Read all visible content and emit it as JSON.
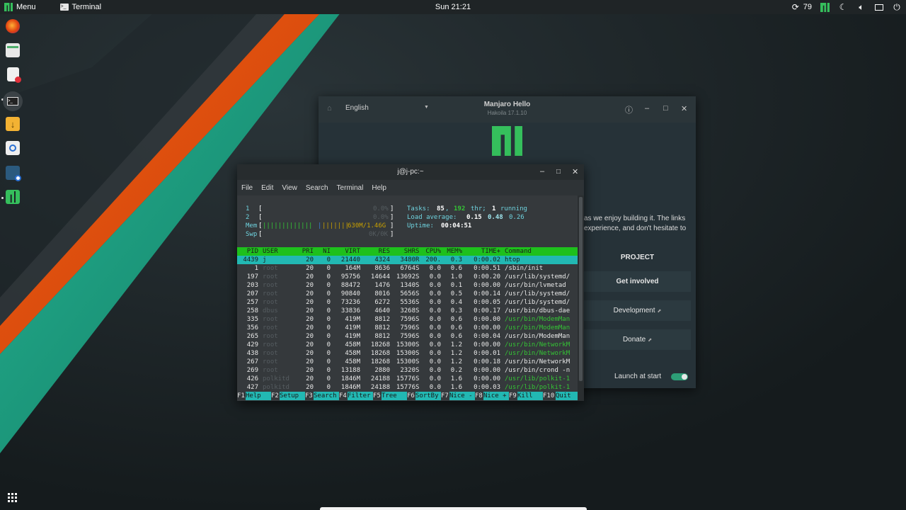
{
  "panel": {
    "menu_label": "Menu",
    "task_label": "Terminal",
    "clock": "Sun 21:21",
    "updates_count": "79"
  },
  "colors": {
    "accent": "#35bf5c",
    "orange_stripe": "#e4510e",
    "teal_stripe": "#1ea285",
    "htop_header": "#1ec01c",
    "htop_selected": "#22b8b3"
  },
  "dock": {
    "icons": [
      "firefox-icon",
      "file-manager-icon",
      "document-viewer-icon",
      "terminal-icon",
      "downloader-icon",
      "screenshot-icon",
      "settings-icon",
      "manjaro-hello-icon"
    ]
  },
  "hello": {
    "language": "English",
    "title": "Manjaro Hello",
    "subtitle": "Hakoila 17.1.10",
    "intro_line1": "as we enjoy building it. The links",
    "intro_line2": "experience, and don't hesitate to",
    "section_project": "PROJECT",
    "get_involved": "Get involved",
    "development": "Development",
    "donate": "Donate",
    "launch_label": "Launch at start",
    "launch_on": true
  },
  "terminal": {
    "title": "j@j-pc:~",
    "menu": [
      "File",
      "Edit",
      "View",
      "Search",
      "Terminal",
      "Help"
    ],
    "meters": {
      "cpu1_label": "1",
      "cpu1_value": "0.0%",
      "cpu2_label": "2",
      "cpu2_value": "0.0%",
      "mem_label": "Mem",
      "mem_value": "630M/1.46G",
      "swp_label": "Swp",
      "swp_value": "0K/0K"
    },
    "tasks": {
      "tasks_label": "Tasks:",
      "tasks": "85",
      "thr": "192",
      "thr_label": "thr;",
      "running": "1",
      "running_label": "running",
      "load_label": "Load average:",
      "load1": "0.15",
      "load5": "0.48",
      "load15": "0.26",
      "uptime_label": "Uptime:",
      "uptime": "00:04:51"
    },
    "columns": [
      "PID",
      "USER",
      "PRI",
      "NI",
      "VIRT",
      "RES",
      "SHR",
      "S",
      "CPU%",
      "MEM%",
      "TIME+",
      "Command"
    ],
    "rows": [
      [
        "4439",
        "j",
        "20",
        "0",
        "21440",
        "4324",
        "3480",
        "R",
        "200.",
        "0.3",
        "0:00.02",
        "htop"
      ],
      [
        "1",
        "root",
        "20",
        "0",
        "164M",
        "8636",
        "6764",
        "S",
        "0.0",
        "0.6",
        "0:00.51",
        "/sbin/init"
      ],
      [
        "197",
        "root",
        "20",
        "0",
        "95756",
        "14644",
        "13692",
        "S",
        "0.0",
        "1.0",
        "0:00.20",
        "/usr/lib/systemd/"
      ],
      [
        "203",
        "root",
        "20",
        "0",
        "88472",
        "1476",
        "1340",
        "S",
        "0.0",
        "0.1",
        "0:00.00",
        "/usr/bin/lvmetad"
      ],
      [
        "207",
        "root",
        "20",
        "0",
        "90840",
        "8016",
        "5656",
        "S",
        "0.0",
        "0.5",
        "0:00.14",
        "/usr/lib/systemd/"
      ],
      [
        "257",
        "root",
        "20",
        "0",
        "73236",
        "6272",
        "5536",
        "S",
        "0.0",
        "0.4",
        "0:00.05",
        "/usr/lib/systemd/"
      ],
      [
        "258",
        "dbus",
        "20",
        "0",
        "33836",
        "4640",
        "3268",
        "S",
        "0.0",
        "0.3",
        "0:00.17",
        "/usr/bin/dbus-dae"
      ],
      [
        "335",
        "root",
        "20",
        "0",
        "419M",
        "8812",
        "7596",
        "S",
        "0.0",
        "0.6",
        "0:00.00",
        "/usr/bin/ModemMan"
      ],
      [
        "356",
        "root",
        "20",
        "0",
        "419M",
        "8812",
        "7596",
        "S",
        "0.0",
        "0.6",
        "0:00.00",
        "/usr/bin/ModemMan"
      ],
      [
        "265",
        "root",
        "20",
        "0",
        "419M",
        "8812",
        "7596",
        "S",
        "0.0",
        "0.6",
        "0:00.04",
        "/usr/bin/ModemMan"
      ],
      [
        "429",
        "root",
        "20",
        "0",
        "458M",
        "18268",
        "15300",
        "S",
        "0.0",
        "1.2",
        "0:00.00",
        "/usr/bin/NetworkM"
      ],
      [
        "438",
        "root",
        "20",
        "0",
        "458M",
        "18268",
        "15300",
        "S",
        "0.0",
        "1.2",
        "0:00.01",
        "/usr/bin/NetworkM"
      ],
      [
        "267",
        "root",
        "20",
        "0",
        "458M",
        "18268",
        "15300",
        "S",
        "0.0",
        "1.2",
        "0:00.18",
        "/usr/bin/NetworkM"
      ],
      [
        "269",
        "root",
        "20",
        "0",
        "13188",
        "2880",
        "2320",
        "S",
        "0.0",
        "0.2",
        "0:00.00",
        "/usr/bin/crond -n"
      ],
      [
        "426",
        "polkitd",
        "20",
        "0",
        "1846M",
        "24188",
        "15776",
        "S",
        "0.0",
        "1.6",
        "0:00.00",
        "/usr/lib/polkit-1"
      ],
      [
        "427",
        "polkitd",
        "20",
        "0",
        "1846M",
        "24188",
        "15776",
        "S",
        "0.0",
        "1.6",
        "0:00.03",
        "/usr/lib/polkit-1"
      ]
    ],
    "green_cmd_rows": [
      7,
      8,
      10,
      11,
      14,
      15
    ],
    "fkeys": [
      {
        "key": "F1",
        "label": "Help"
      },
      {
        "key": "F2",
        "label": "Setup"
      },
      {
        "key": "F3",
        "label": "Search"
      },
      {
        "key": "F4",
        "label": "Filter"
      },
      {
        "key": "F5",
        "label": "Tree"
      },
      {
        "key": "F6",
        "label": "SortBy"
      },
      {
        "key": "F7",
        "label": "Nice -"
      },
      {
        "key": "F8",
        "label": "Nice +"
      },
      {
        "key": "F9",
        "label": "Kill"
      },
      {
        "key": "F10",
        "label": "Quit"
      }
    ]
  }
}
